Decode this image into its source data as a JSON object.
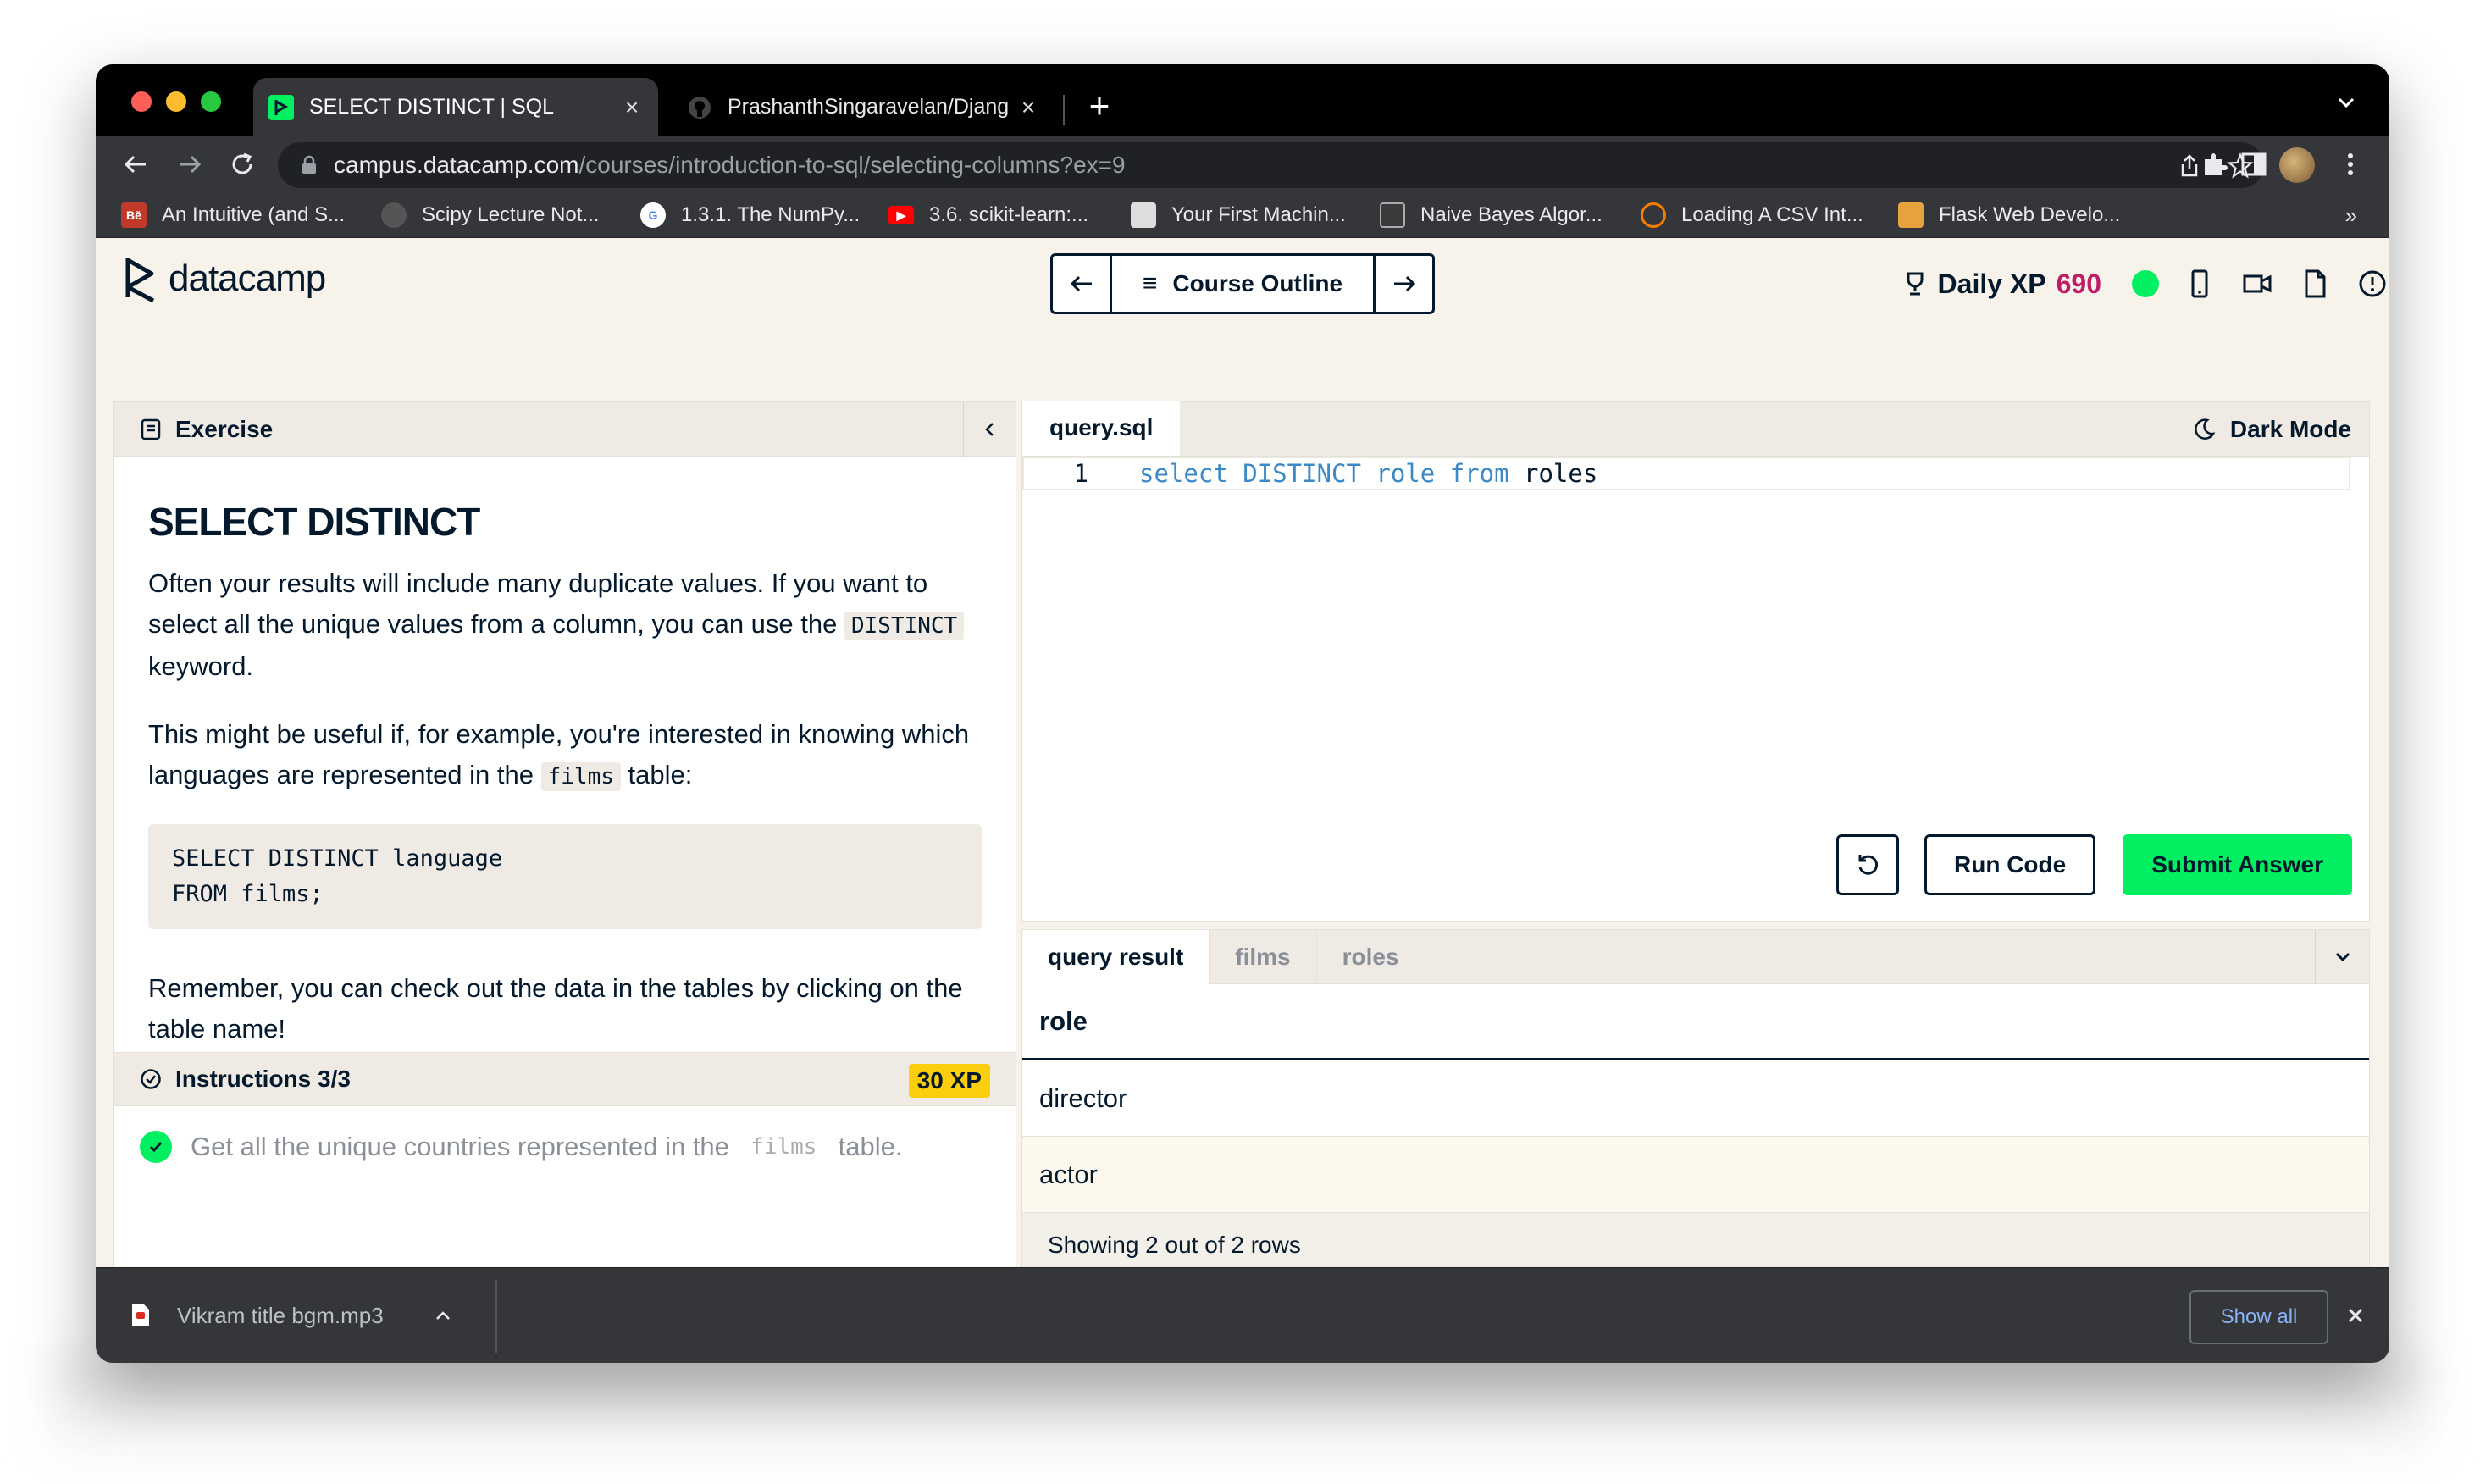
{
  "browser": {
    "tabs": [
      {
        "title": "SELECT DISTINCT | SQL",
        "active": true
      },
      {
        "title": "PrashanthSingaravelan/Djang",
        "active": false
      }
    ],
    "url_host": "campus.datacamp.com",
    "url_path": "/courses/introduction-to-sql/selecting-columns?ex=9",
    "bookmarks": [
      "An Intuitive (and S...",
      "Scipy Lecture Not...",
      "1.3.1. The NumPy...",
      "3.6. scikit-learn:...",
      "Your First Machin...",
      "Naive Bayes Algor...",
      "Loading A CSV Int...",
      "Flask Web Develo..."
    ],
    "bookmarks_more": "»"
  },
  "header": {
    "logo_text": "datacamp",
    "course_outline": "Course Outline",
    "daily_xp_label": "Daily XP",
    "daily_xp_value": "690"
  },
  "exercise": {
    "panel_label": "Exercise",
    "title": "SELECT DISTINCT",
    "p1_before": "Often your results will include many duplicate values. If you want to select all the unique values from a column, you can use the",
    "p1_code": "DISTINCT",
    "p1_after": "keyword.",
    "p2_before": "This might be useful if, for example, you're interested in knowing which languages are represented in the",
    "p2_code": "films",
    "p2_after": "table:",
    "codeblock": "SELECT DISTINCT language\nFROM films;",
    "p3": "Remember, you can check out the data in the tables by clicking on the table name!",
    "instructions_label": "Instructions 3/3",
    "xp_badge": "30 XP",
    "task_before": "Get all the unique countries represented in the",
    "task_code": "films",
    "task_after": "table."
  },
  "editor": {
    "file_tab": "query.sql",
    "dark_mode": "Dark Mode",
    "line_number": "1",
    "code_kw1": "select",
    "code_kw2": "DISTINCT",
    "code_col": "role",
    "code_kw3": "from",
    "code_table": "roles",
    "run_label": "Run Code",
    "submit_label": "Submit Answer"
  },
  "results": {
    "tabs": [
      "query result",
      "films",
      "roles"
    ],
    "column": "role",
    "rows": [
      "director",
      "actor"
    ],
    "footer": "Showing 2 out of 2 rows"
  },
  "progress": {
    "segments": 4,
    "current_fill": 0.82
  },
  "downloads": {
    "filename": "Vikram title bgm.mp3",
    "show_all": "Show all"
  },
  "colors": {
    "accent_green": "#03ef62",
    "navy": "#05192d",
    "xp_pink": "#be1e68",
    "badge_yellow": "#fcce0d",
    "progress_blue": "#3ea5e8"
  }
}
